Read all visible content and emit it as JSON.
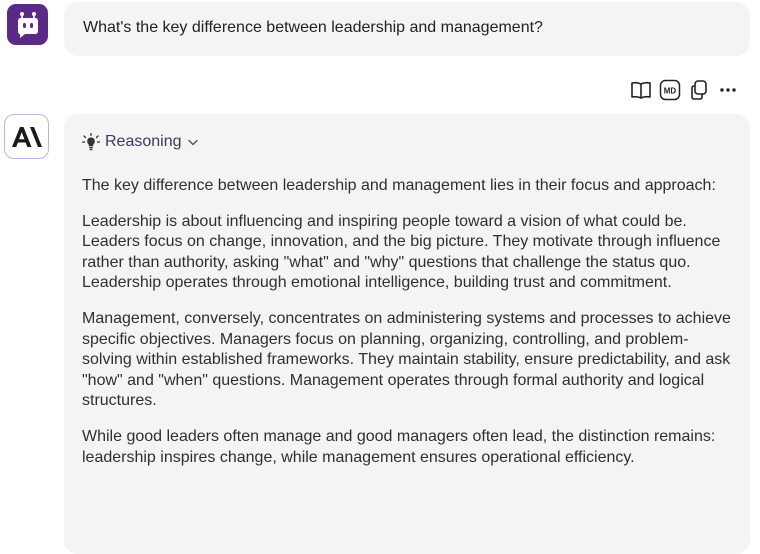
{
  "user": {
    "message": "What's the key difference between leadership and management?"
  },
  "toolbar": {
    "icons": [
      "book-icon",
      "markdown-icon",
      "copy-icon",
      "more-icon"
    ],
    "md_label": "MD",
    "more_label": "···"
  },
  "assistant": {
    "reasoning_label": "Reasoning",
    "paragraphs": [
      "The key difference between leadership and management lies in their focus and approach:",
      "Leadership is about influencing and inspiring people toward a vision of what could be. Leaders focus on change, innovation, and the big picture. They motivate through influence rather than authority, asking \"what\" and \"why\" questions that challenge the status quo. Leadership operates through emotional intelligence, building trust and commitment.",
      "Management, conversely, concentrates on administering systems and processes to achieve specific objectives. Managers focus on planning, organizing, controlling, and problem-solving within established frameworks. They maintain stability, ensure predictability, and ask \"how\" and \"when\" questions. Management operates through formal authority and logical structures.",
      "While good leaders often manage and good managers often lead, the distinction remains: leadership inspires change, while management ensures operational efficiency."
    ]
  },
  "colors": {
    "user_avatar_bg": "#5b2a86",
    "bubble_bg": "#f4f4f5",
    "ai_avatar_border": "#bdb3e8"
  }
}
